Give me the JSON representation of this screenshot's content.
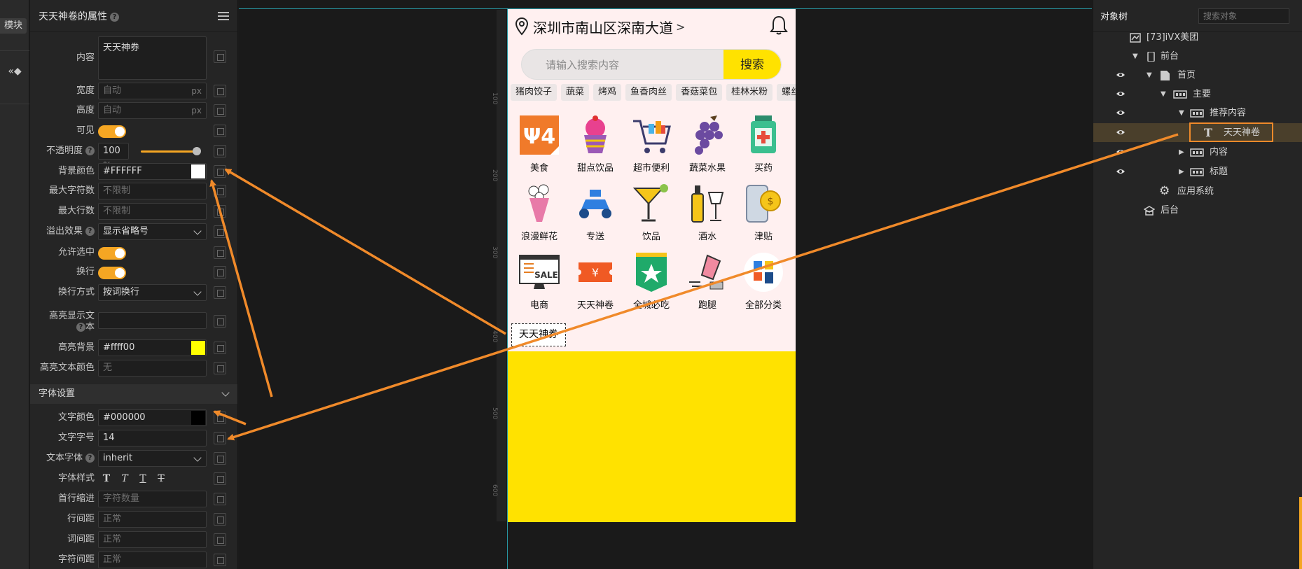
{
  "left_strip": {
    "module_label": "模块",
    "collapse_icon": "«◆"
  },
  "props": {
    "title": "天天神卷的属性",
    "content_label": "内容",
    "content_value": "天天神券",
    "width_label": "宽度",
    "width_placeholder": "自动",
    "width_unit": "px",
    "height_label": "高度",
    "height_placeholder": "自动",
    "height_unit": "px",
    "visible_label": "可见",
    "opacity_label": "不透明度",
    "opacity_value": "100",
    "opacity_unit": "%",
    "bg_color_label": "背景颜色",
    "bg_color_value": "#FFFFFF",
    "max_chars_label": "最大字符数",
    "max_chars_placeholder": "不限制",
    "max_lines_label": "最大行数",
    "max_lines_placeholder": "不限制",
    "overflow_label": "溢出效果",
    "overflow_value": "显示省略号",
    "allow_select_label": "允许选中",
    "wrap_label": "换行",
    "wrap_mode_label": "换行方式",
    "wrap_mode_value": "按词换行",
    "highlight_text_label_1": "高亮显示文",
    "highlight_text_label_2": "本",
    "highlight_bg_label": "高亮背景",
    "highlight_bg_value": "#ffff00",
    "highlight_text_color_label": "高亮文本颜色",
    "highlight_text_color_placeholder": "无",
    "font_section": "字体设置",
    "text_color_label": "文字颜色",
    "text_color_value": "#000000",
    "font_size_label": "文字字号",
    "font_size_value": "14",
    "font_family_label": "文本字体",
    "font_family_value": "inherit",
    "font_style_label": "字体样式",
    "indent_label": "首行缩进",
    "indent_placeholder": "字符数量",
    "line_height_label": "行间距",
    "line_height_placeholder": "正常",
    "word_spacing_label": "词间距",
    "word_spacing_placeholder": "正常",
    "letter_spacing_label": "字符间距",
    "letter_spacing_placeholder": "正常"
  },
  "phone": {
    "address": "深圳市南山区深南大道",
    "address_arrow": ">",
    "search_placeholder": "请输入搜索内容",
    "search_button": "搜索",
    "tags": [
      "猪肉饺子",
      "蔬菜",
      "烤鸡",
      "鱼香肉丝",
      "香菇菜包",
      "桂林米粉",
      "螺丝"
    ],
    "categories": [
      {
        "name": "美食",
        "icon": "food-icon"
      },
      {
        "name": "甜点饮品",
        "icon": "cupcake-icon"
      },
      {
        "name": "超市便利",
        "icon": "cart-icon"
      },
      {
        "name": "蔬菜水果",
        "icon": "grape-icon"
      },
      {
        "name": "买药",
        "icon": "medicine-icon"
      },
      {
        "name": "浪漫鲜花",
        "icon": "flower-icon"
      },
      {
        "name": "专送",
        "icon": "scooter-icon"
      },
      {
        "name": "饮品",
        "icon": "cocktail-icon"
      },
      {
        "name": "酒水",
        "icon": "wine-icon"
      },
      {
        "name": "津贴",
        "icon": "subsidy-icon"
      },
      {
        "name": "电商",
        "icon": "sale-icon"
      },
      {
        "name": "天天神卷",
        "icon": "coupon-icon"
      },
      {
        "name": "全城必吃",
        "icon": "star-badge-icon"
      },
      {
        "name": "跑腿",
        "icon": "runner-icon"
      },
      {
        "name": "全部分类",
        "icon": "all-categories-icon"
      }
    ],
    "selected_text": "天天神券"
  },
  "ruler": [
    "100",
    "200",
    "300",
    "400",
    "500",
    "600"
  ],
  "tree": {
    "title": "对象树",
    "search_placeholder": "搜索对象",
    "nodes": [
      {
        "label": "[73]iVX美团"
      },
      {
        "label": "前台"
      },
      {
        "label": "首页"
      },
      {
        "label": "主要"
      },
      {
        "label": "推荐内容"
      },
      {
        "label": "天天神卷"
      },
      {
        "label": "内容"
      },
      {
        "label": "标题"
      },
      {
        "label": "应用系统"
      },
      {
        "label": "后台"
      }
    ]
  },
  "colors": {
    "accent": "#f5a623",
    "arrow": "#f08a2a",
    "brand_yellow": "#ffe200",
    "guide": "#2ab7c6"
  }
}
